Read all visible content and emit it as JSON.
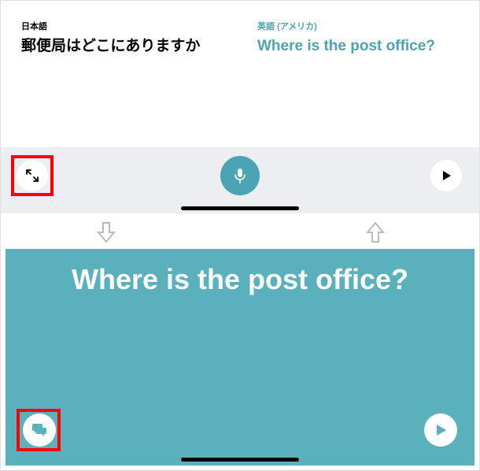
{
  "source": {
    "label": "日本語",
    "text": "郵便局はどこにありますか"
  },
  "target": {
    "label": "英語 (アメリカ)",
    "text": "Where is the post office?"
  },
  "fullscreen": {
    "text": "Where is the post office?"
  }
}
